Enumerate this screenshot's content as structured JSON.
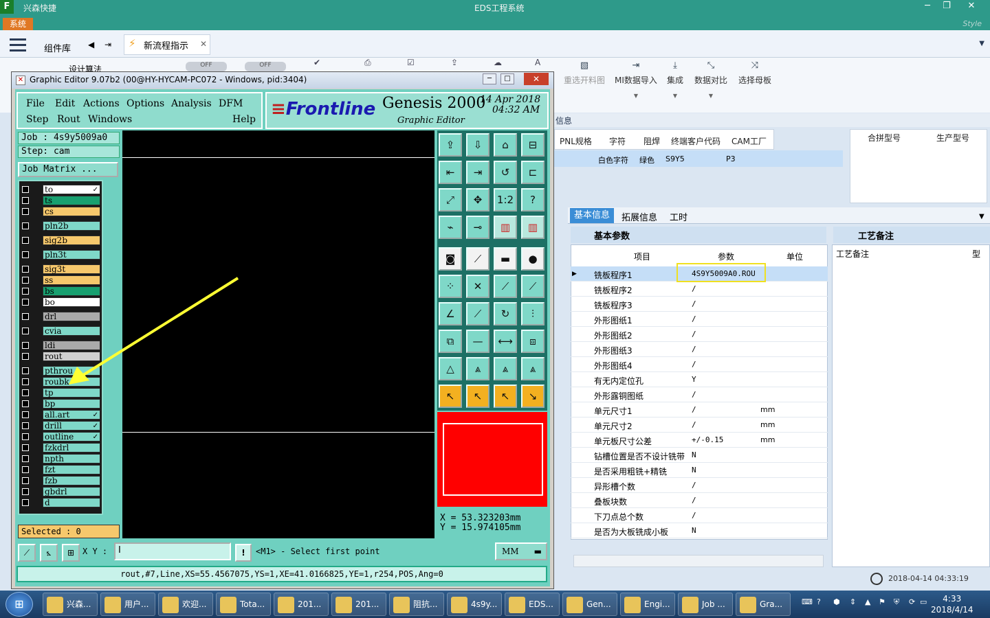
{
  "app": {
    "name": "兴森快捷",
    "title": "EDS工程系统",
    "system_btn": "系统",
    "style_label": "Style"
  },
  "header": {
    "component_lib": "组件库",
    "tab_label": "新流程指示",
    "hidden_row": "设计算法",
    "off1": "OFF",
    "off2": "OFF"
  },
  "ribbon": [
    {
      "icon": "image-icon",
      "label": "重选开料图"
    },
    {
      "icon": "import-icon",
      "label": "MI数据导入"
    },
    {
      "icon": "download-icon",
      "label": "集成"
    },
    {
      "icon": "compare-icon",
      "label": "数据对比"
    },
    {
      "icon": "shuffle-icon",
      "label": "选择母板"
    }
  ],
  "info": {
    "section": "信息",
    "columns": [
      "PNL规格",
      "字符",
      "阻焊",
      "终端客户代码",
      "CAM工厂"
    ],
    "row": [
      "",
      "白色字符",
      "绿色",
      "S9Y5",
      "P3"
    ],
    "right_columns": [
      "合拼型号",
      "生产型号"
    ]
  },
  "tabs2": [
    "基本信息",
    "拓展信息",
    "工时"
  ],
  "basic_params": "基本参数",
  "process_notes": "工艺备注",
  "grid": {
    "headers": [
      "项目",
      "参数",
      "单位"
    ],
    "rows": [
      [
        "铣板程序1",
        "4S9Y5009A0.ROU",
        ""
      ],
      [
        "铣板程序2",
        "/",
        ""
      ],
      [
        "铣板程序3",
        "/",
        ""
      ],
      [
        "外形图纸1",
        "/",
        ""
      ],
      [
        "外形图纸2",
        "/",
        ""
      ],
      [
        "外形图纸3",
        "/",
        ""
      ],
      [
        "外形图纸4",
        "/",
        ""
      ],
      [
        "有无内定位孔",
        "Y",
        ""
      ],
      [
        "外形露铜图纸",
        "/",
        ""
      ],
      [
        "单元尺寸1",
        "/",
        "mm"
      ],
      [
        "单元尺寸2",
        "/",
        "mm"
      ],
      [
        "单元板尺寸公差",
        "+/-0.15",
        "mm"
      ],
      [
        "钻槽位置是否不设计铣带",
        "N",
        ""
      ],
      [
        "是否采用粗铣+精铣",
        "N",
        ""
      ],
      [
        "异形槽个数",
        "/",
        ""
      ],
      [
        "叠板块数",
        "/",
        ""
      ],
      [
        "下刀点总个数",
        "/",
        ""
      ],
      [
        "是否为大板铣成小板",
        "N",
        ""
      ]
    ],
    "notes_col": "工艺备注",
    "notes_col2": "型"
  },
  "datetime_panel": "2018-04-14 04:33:19",
  "ge": {
    "title": "Graphic Editor 9.07b2 (00@HY-HYCAM-PC072 - Windows, pid:3404)",
    "menu_row1": [
      "File",
      "Edit",
      "Actions",
      "Options",
      "Analysis",
      "DFM"
    ],
    "menu_row2": [
      "Step",
      "Rout",
      "Windows",
      "Help"
    ],
    "brand": "Frontline",
    "product": "Genesis 2000",
    "subtitle": "Graphic Editor",
    "date": "14 Apr 2018",
    "time": "04:32 AM",
    "job": "Job : 4s9y5009a0",
    "step": "Step: cam",
    "job_matrix": "Job Matrix ...",
    "layers": [
      {
        "name": "to",
        "color": "#ffffff",
        "mark": "✓"
      },
      {
        "name": "ts",
        "color": "#18a070",
        "mark": ""
      },
      {
        "name": "cs",
        "color": "#f6c86c",
        "mark": ""
      },
      {
        "name": "pln2b",
        "color": "#7fd8c8",
        "mark": ""
      },
      {
        "name": "sig2b",
        "color": "#f6c86c",
        "mark": ""
      },
      {
        "name": "pln3t",
        "color": "#7fd8c8",
        "mark": ""
      },
      {
        "name": "sig3t",
        "color": "#f6c86c",
        "mark": ""
      },
      {
        "name": "ss",
        "color": "#f6c86c",
        "mark": ""
      },
      {
        "name": "bs",
        "color": "#18a070",
        "mark": ""
      },
      {
        "name": "bo",
        "color": "#ffffff",
        "mark": ""
      },
      {
        "name": "drl",
        "color": "#aaaaaa",
        "mark": ""
      },
      {
        "name": "cvia",
        "color": "#7fd8c8",
        "mark": ""
      },
      {
        "name": "ldi",
        "color": "#aaaaaa",
        "mark": ""
      },
      {
        "name": "rout",
        "color": "#d0d0d0",
        "mark": ""
      },
      {
        "name": "pthrou",
        "color": "#7fd8c8",
        "mark": ""
      },
      {
        "name": "roubk",
        "color": "#7fd8c8",
        "mark": ""
      },
      {
        "name": "tp",
        "color": "#7fd8c8",
        "mark": ""
      },
      {
        "name": "bp",
        "color": "#7fd8c8",
        "mark": ""
      },
      {
        "name": "all.art",
        "color": "#7fd8c8",
        "mark": "✓"
      },
      {
        "name": "drill",
        "color": "#7fd8c8",
        "mark": "✓"
      },
      {
        "name": "outline",
        "color": "#7fd8c8",
        "mark": "✓"
      },
      {
        "name": "fzkdrl",
        "color": "#7fd8c8",
        "mark": ""
      },
      {
        "name": "npth",
        "color": "#7fd8c8",
        "mark": ""
      },
      {
        "name": "fzt",
        "color": "#7fd8c8",
        "mark": ""
      },
      {
        "name": "fzb",
        "color": "#7fd8c8",
        "mark": ""
      },
      {
        "name": "gbdrl",
        "color": "#7fd8c8",
        "mark": ""
      },
      {
        "name": "d",
        "color": "#7fd8c8",
        "mark": ""
      }
    ],
    "selected": "Selected : 0",
    "tools": [
      "⇪",
      "⇩",
      "⌂",
      "⊟",
      "⇤",
      "⇥",
      "↺",
      "⊏",
      "⤢",
      "✥",
      "1:2",
      "?",
      "⌁",
      "⊸",
      "▥",
      "▥",
      "◙",
      "⟋",
      "▬",
      "●",
      "⁘",
      "✕",
      "⟋",
      "⟋",
      "∠",
      "⟋",
      "↻",
      "⫶",
      "⧉",
      "—",
      "⟷",
      "⧈",
      "△",
      "⩓",
      "⩓",
      "⩓",
      "↖",
      "↖",
      "↖",
      "↘"
    ],
    "coord_x": "X  =  53.323203mm",
    "coord_y": "Y  =  15.974105mm",
    "xy_label": "X Y :",
    "prompt": "<M1> - Select first point",
    "units": "MM",
    "status": "rout,#7,Line,XS=55.4567075,YS=1,XE=41.0166825,YE=1,r254,POS,Ang=0"
  },
  "taskbar": {
    "items": [
      "兴森...",
      "用户...",
      "欢迎...",
      "Tota...",
      "201...",
      "201...",
      "阻抗...",
      "4s9y...",
      "EDS...",
      "Gen...",
      "Engi...",
      "Job ...",
      "Gra..."
    ],
    "time": "4:33",
    "date": "2018/4/14"
  }
}
